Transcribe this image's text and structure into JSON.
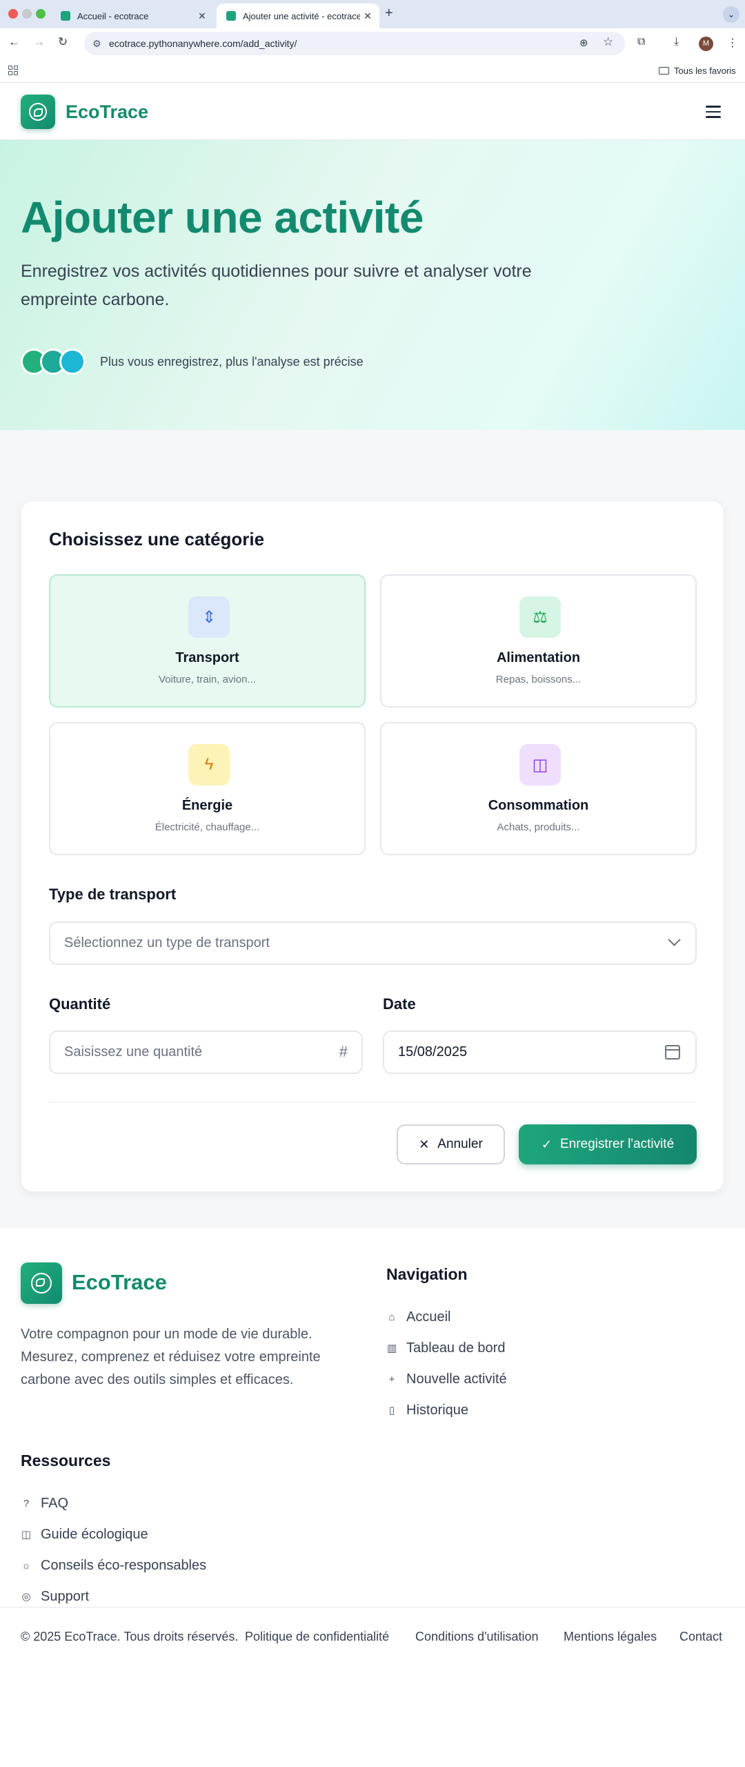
{
  "browser": {
    "tabs": [
      {
        "title": "Accueil - ecotrace"
      },
      {
        "title": "Ajouter une activité - ecotrace"
      }
    ],
    "url": "ecotrace.pythonanywhere.com/add_activity/",
    "bookmarks_label": "Tous les favoris",
    "profile_initial": "M"
  },
  "header": {
    "brand": "EcoTrace"
  },
  "hero": {
    "title": "Ajouter une activité",
    "subtitle": "Enregistrez vos activités quotidiennes pour suivre et analyser votre empreinte carbone.",
    "note": "Plus vous enregistrez, plus l'analyse est précise"
  },
  "form": {
    "category_heading": "Choisissez une catégorie",
    "categories": [
      {
        "name": "Transport",
        "description": "Voiture, train, avion...",
        "icon": "transport-icon",
        "selected": true
      },
      {
        "name": "Alimentation",
        "description": "Repas, boissons...",
        "icon": "scale-icon",
        "selected": false
      },
      {
        "name": "Énergie",
        "description": "Électricité, chauffage...",
        "icon": "lightning-icon",
        "selected": false
      },
      {
        "name": "Consommation",
        "description": "Achats, produits...",
        "icon": "shopping-bag-icon",
        "selected": false
      }
    ],
    "transport_type_label": "Type de transport",
    "transport_type_placeholder": "Sélectionnez un type de transport",
    "quantity_label": "Quantité",
    "quantity_placeholder": "Saisissez une quantité",
    "date_label": "Date",
    "date_value": "15/08/2025",
    "cancel_label": "Annuler",
    "save_label": "Enregistrer l'activité"
  },
  "footer": {
    "brand": "EcoTrace",
    "description": "Votre compagnon pour un mode de vie durable. Mesurez, comprenez et réduisez votre empreinte carbone avec des outils simples et efficaces.",
    "navigation_heading": "Navigation",
    "navigation": [
      {
        "label": "Accueil",
        "icon": "home-icon"
      },
      {
        "label": "Tableau de bord",
        "icon": "bar-chart-icon"
      },
      {
        "label": "Nouvelle activité",
        "icon": "plus-icon"
      },
      {
        "label": "Historique",
        "icon": "clipboard-icon"
      }
    ],
    "resources_heading": "Ressources",
    "resources": [
      {
        "label": "FAQ",
        "icon": "help-circle-icon"
      },
      {
        "label": "Guide écologique",
        "icon": "book-icon"
      },
      {
        "label": "Conseils éco-responsables",
        "icon": "lightbulb-icon"
      },
      {
        "label": "Support",
        "icon": "lifebuoy-icon"
      }
    ],
    "copyright": "© 2025 EcoTrace. Tous droits réservés.",
    "legal_links": [
      "Politique de confidentialité",
      "Conditions d'utilisation",
      "Mentions légales",
      "Contact"
    ]
  },
  "colors": {
    "brand": "#148a6d",
    "accent": "#1fa67d",
    "selected_card_bg": "#e7f9f0"
  }
}
